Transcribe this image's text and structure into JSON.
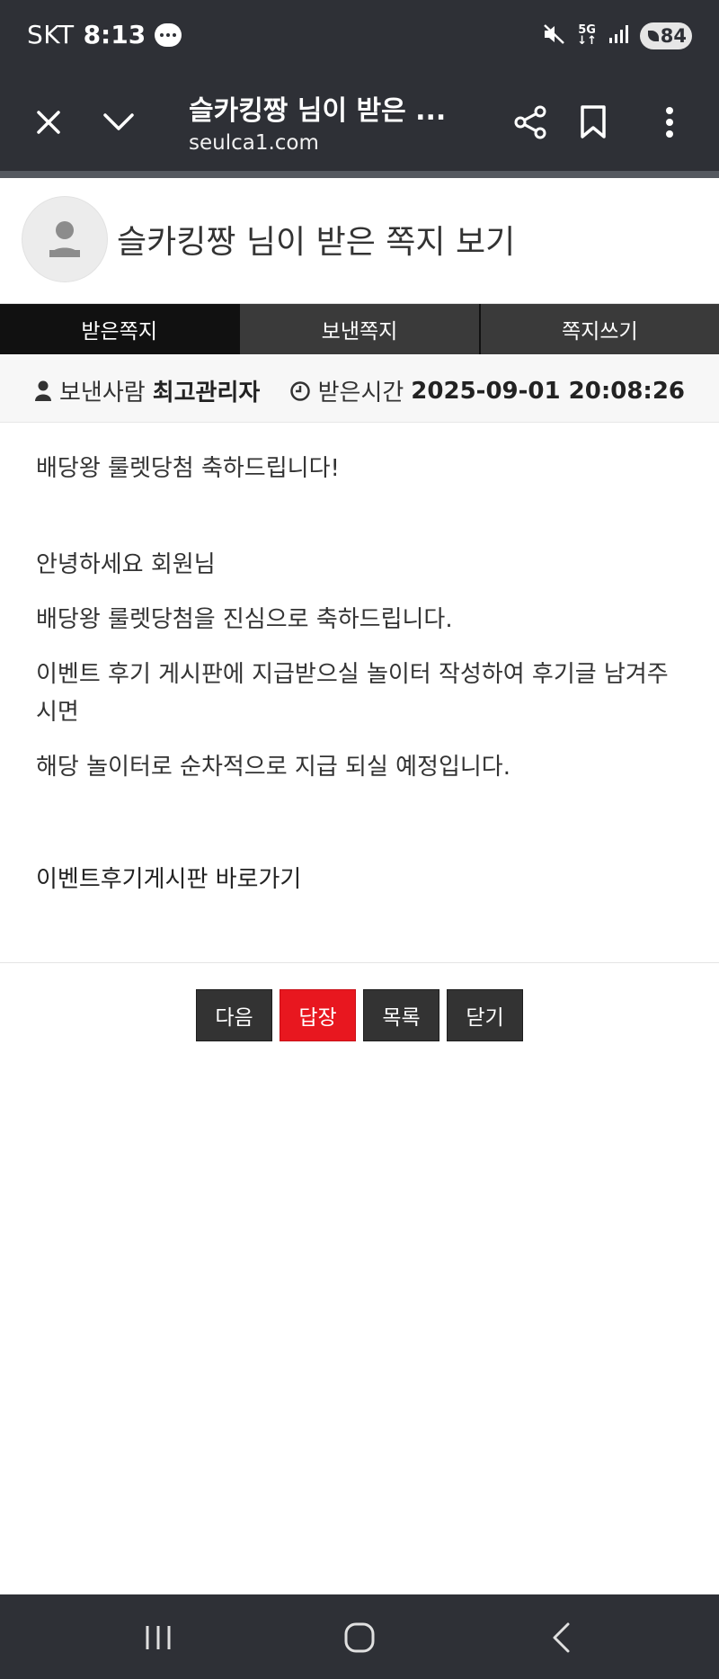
{
  "status_bar": {
    "carrier": "SKT",
    "time": "8:13",
    "network": "5G",
    "battery": "84",
    "icons": [
      "chat-icon",
      "mute-icon",
      "5g-icon",
      "signal-icon",
      "battery-icon"
    ]
  },
  "browser": {
    "title": "슬카킹짱 님이 받은 ...",
    "url": "seulca1.com",
    "icons": [
      "close-icon",
      "chevron-down-icon",
      "share-icon",
      "bookmark-icon",
      "more-icon"
    ]
  },
  "page": {
    "title": "슬카킹짱 님이 받은 쪽지 보기"
  },
  "tabs": [
    {
      "label": "받은쪽지",
      "active": true
    },
    {
      "label": "보낸쪽지",
      "active": false
    },
    {
      "label": "쪽지쓰기",
      "active": false
    }
  ],
  "meta": {
    "sender_label": "보낸사람",
    "sender_name": "최고관리자",
    "time_label": "받은시간",
    "time_value": "2025-09-01 20:08:26"
  },
  "message": {
    "subject": "배당왕 룰렛당첨 축하드립니다!",
    "lines": [
      "안녕하세요 회원님",
      "배당왕 룰렛당첨을 진심으로 축하드립니다.",
      "이벤트 후기 게시판에 지급받으실 놀이터 작성하여 후기글 남겨주시면",
      "해당 놀이터로 순차적으로 지급 되실 예정입니다."
    ],
    "link": "이벤트후기게시판 바로가기"
  },
  "buttons": {
    "next": "다음",
    "reply": "답장",
    "list": "목록",
    "close": "닫기"
  },
  "colors": {
    "header_bg": "#2e3036",
    "reply_red": "#e8171f",
    "tab_active": "#111111",
    "button_dark": "#333333"
  }
}
